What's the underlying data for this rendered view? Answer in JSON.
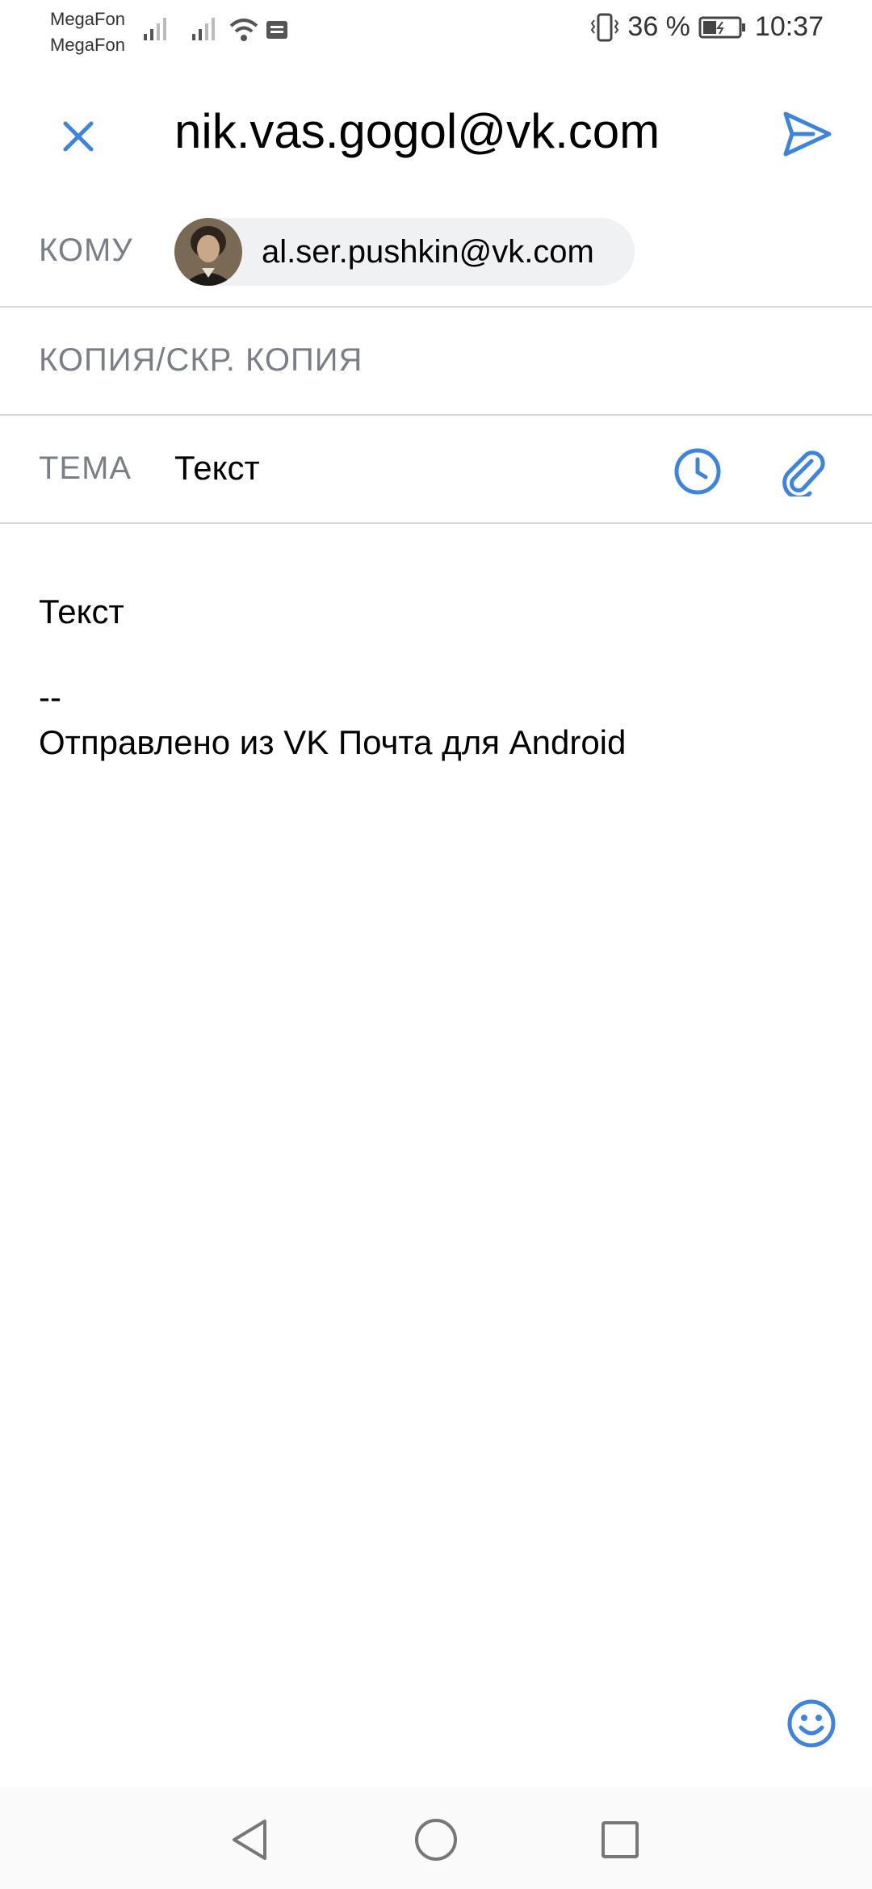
{
  "status_bar": {
    "carrier1": "MegaFon",
    "carrier2": "MegaFon",
    "battery": "36 %",
    "time": "10:37"
  },
  "header": {
    "sender": "nik.vas.gogol@vk.com",
    "close_icon": "close-icon",
    "send_icon": "send-icon"
  },
  "to": {
    "label": "КОМУ",
    "recipient": "al.ser.pushkin@vk.com"
  },
  "cc": {
    "label": "КОПИЯ/СКР. КОПИЯ"
  },
  "subject": {
    "label": "ТЕМА",
    "value": "Текст"
  },
  "body": {
    "text": "Текст",
    "separator": "--",
    "signature": "Отправлено из VK Почта для Android"
  },
  "colors": {
    "accent": "#3f84dc",
    "label": "#7a7f86",
    "divider": "#d8d8d8"
  }
}
